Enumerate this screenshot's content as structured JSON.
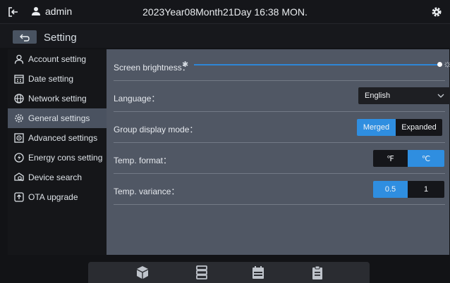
{
  "header": {
    "username": "admin",
    "datetime": "2023Year08Month21Day 16:38 MON."
  },
  "subheader": {
    "title": "Setting"
  },
  "sidebar": {
    "items": [
      {
        "label": "Account setting",
        "icon": "user-icon",
        "active": false
      },
      {
        "label": "Date setting",
        "icon": "calendar-icon",
        "active": false
      },
      {
        "label": "Network setting",
        "icon": "globe-icon",
        "active": false
      },
      {
        "label": "General settings",
        "icon": "gear-icon",
        "active": true
      },
      {
        "label": "Advanced settings",
        "icon": "advanced-icon",
        "active": false
      },
      {
        "label": "Energy cons setting",
        "icon": "energy-icon",
        "active": false
      },
      {
        "label": "Device search",
        "icon": "device-search-icon",
        "active": false
      },
      {
        "label": "OTA upgrade",
        "icon": "upgrade-icon",
        "active": false
      }
    ]
  },
  "settings": {
    "brightness": {
      "label": "Screen brightness：",
      "level": 1.0
    },
    "language": {
      "label": "Language：",
      "value": "English"
    },
    "group_display": {
      "label": "Group display mode：",
      "options": [
        "Merged",
        "Expanded"
      ],
      "selected": "Merged"
    },
    "temp_format": {
      "label": "Temp. format：",
      "options": [
        "℉",
        "℃"
      ],
      "selected": "℃"
    },
    "temp_variance": {
      "label": "Temp. variance：",
      "options": [
        "0.5",
        "1"
      ],
      "selected": "0.5"
    }
  },
  "bottom_nav": {
    "items": [
      {
        "icon": "cube-icon"
      },
      {
        "icon": "server-list-icon"
      },
      {
        "icon": "calendar-schedule-icon"
      },
      {
        "icon": "clipboard-icon"
      }
    ]
  },
  "colors": {
    "accent": "#2f8ee0",
    "sidebar_active": "#4a5260",
    "content_bg": "#505764",
    "app_bg": "#121316"
  }
}
